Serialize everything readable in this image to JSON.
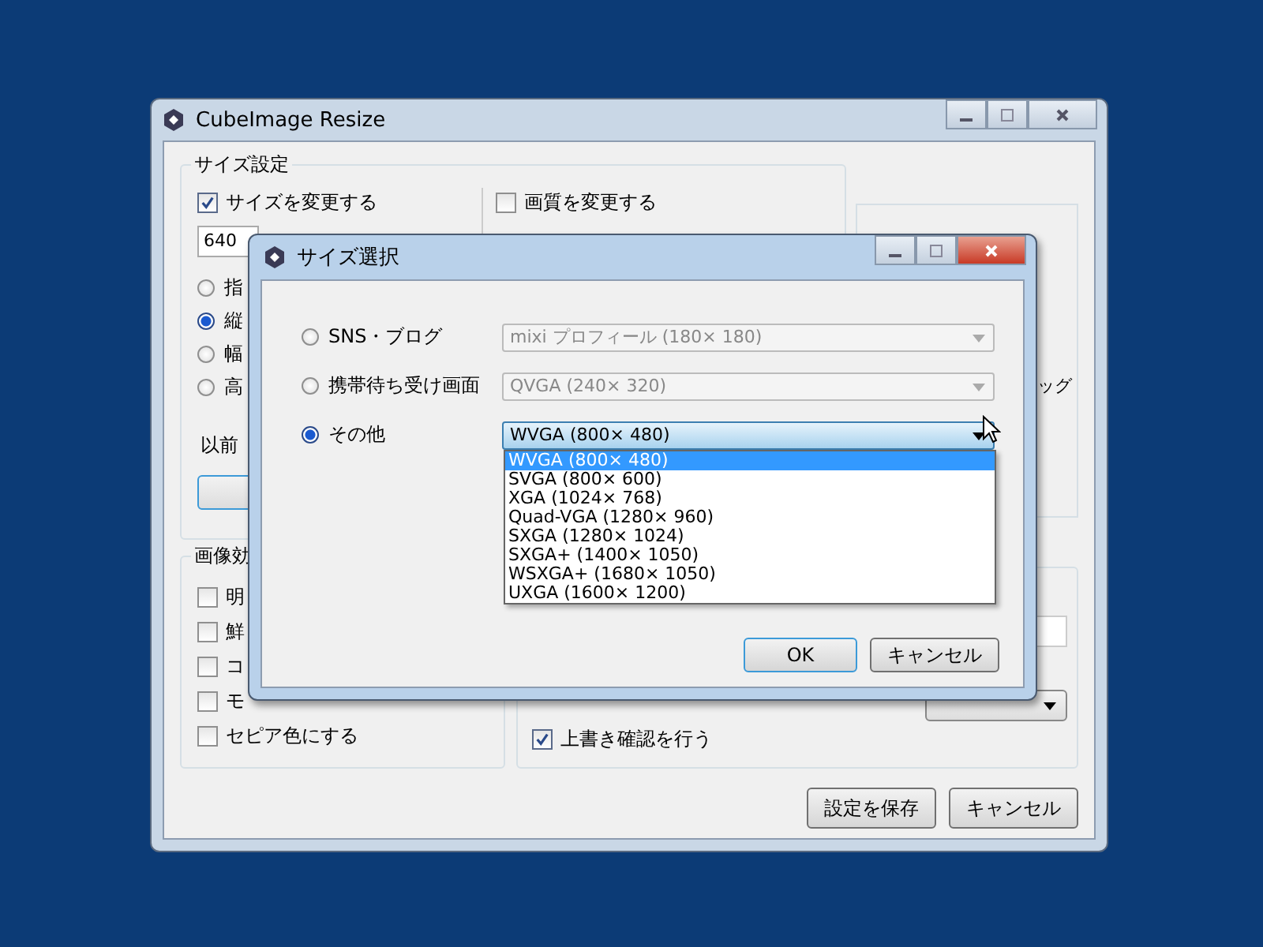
{
  "main_window": {
    "title": "CubeImage Resize",
    "size_group": {
      "label": "サイズ設定",
      "resize_checkbox": {
        "label": "サイズを変更する",
        "checked": true
      },
      "width_value": "640",
      "options": [
        {
          "label": "指",
          "selected": false
        },
        {
          "label": "縦",
          "selected": true
        },
        {
          "label": "幅",
          "selected": false
        },
        {
          "label": "高",
          "selected": false
        }
      ],
      "previous_label": "以前"
    },
    "quality_checkbox": {
      "label": "画質を変更する",
      "checked": false
    },
    "side_text": "ッグ",
    "effects_group": {
      "label": "画像効",
      "items": [
        {
          "label": "明",
          "checked": false
        },
        {
          "label": "鮮",
          "checked": false
        },
        {
          "label": "コ",
          "checked": false
        },
        {
          "label": "モ",
          "checked": false
        },
        {
          "label": "セピア色にする",
          "checked": false
        }
      ]
    },
    "overwrite_checkbox": {
      "label": "上書き確認を行う",
      "checked": true
    },
    "buttons": [
      "設定を保存",
      "キャンセル"
    ]
  },
  "dialog": {
    "title": "サイズ選択",
    "rows": [
      {
        "label": "SNS・ブログ",
        "selected": false,
        "value": "mixi プロフィール (180× 180)",
        "disabled": true,
        "expanded": false
      },
      {
        "label": "携帯待ち受け画面",
        "selected": false,
        "value": "QVGA (240× 320)",
        "disabled": true,
        "expanded": false
      },
      {
        "label": "その他",
        "selected": true,
        "value": "WVGA (800× 480)",
        "disabled": false,
        "expanded": true
      }
    ],
    "options": [
      {
        "label": "WVGA (800× 480)",
        "selected": true
      },
      {
        "label": "SVGA (800× 600)",
        "selected": false
      },
      {
        "label": "XGA (1024× 768)",
        "selected": false
      },
      {
        "label": "Quad-VGA (1280× 960)",
        "selected": false
      },
      {
        "label": "SXGA (1280× 1024)",
        "selected": false
      },
      {
        "label": "SXGA+ (1400× 1050)",
        "selected": false
      },
      {
        "label": "WSXGA+ (1680× 1050)",
        "selected": false
      },
      {
        "label": "UXGA (1600× 1200)",
        "selected": false
      }
    ],
    "buttons": [
      "OK",
      "キャンセル"
    ]
  }
}
